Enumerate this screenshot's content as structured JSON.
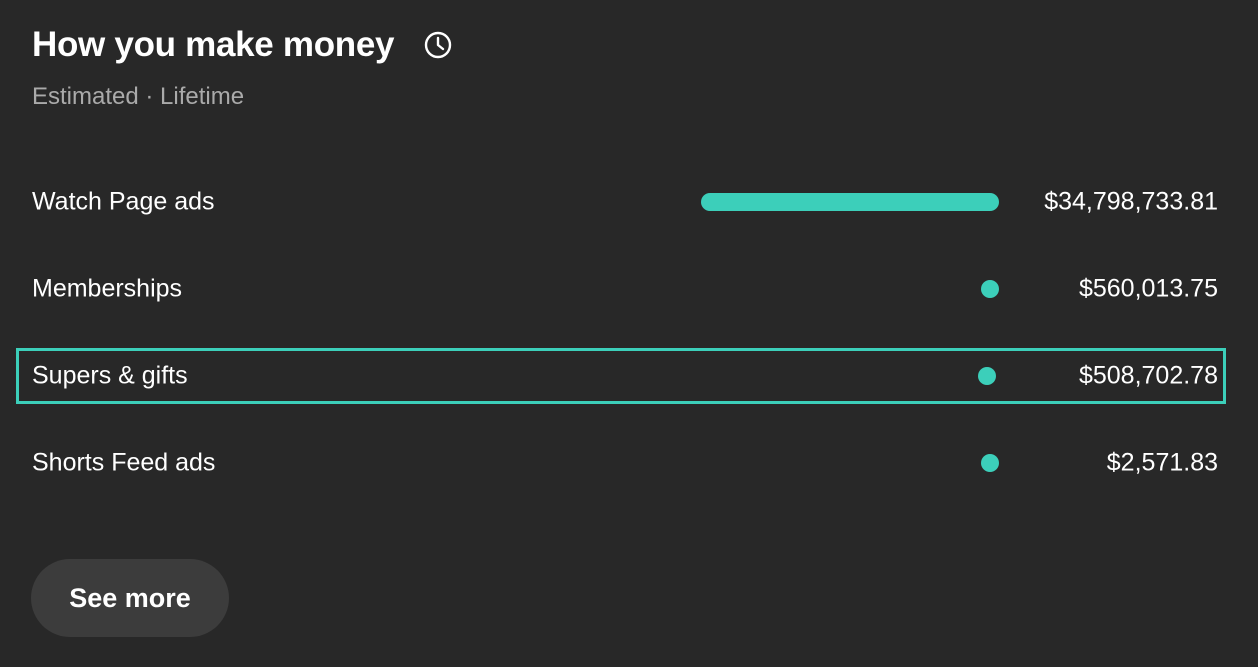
{
  "card": {
    "title": "How you make money",
    "subtitle": "Estimated · Lifetime",
    "history_icon": "history-clock-icon"
  },
  "revenue_sources": [
    {
      "label": "Watch Page ads",
      "value": "$34,798,733.81",
      "amount": 34798733.81,
      "share_of_max": 1.0,
      "selected": false
    },
    {
      "label": "Memberships",
      "value": "$560,013.75",
      "amount": 560013.75,
      "share_of_max": 0.0161,
      "selected": false
    },
    {
      "label": "Supers & gifts",
      "value": "$508,702.78",
      "amount": 508702.78,
      "share_of_max": 0.0146,
      "selected": true
    },
    {
      "label": "Shorts Feed ads",
      "value": "$2,571.83",
      "amount": 2571.83,
      "share_of_max": 0.0001,
      "selected": false
    }
  ],
  "colors": {
    "background": "#282828",
    "accent": "#3ccfba",
    "text_primary": "#ffffff",
    "text_secondary": "#aaaaaa",
    "button_bg": "#3c3c3c"
  },
  "actions": {
    "see_more_label": "See more"
  }
}
